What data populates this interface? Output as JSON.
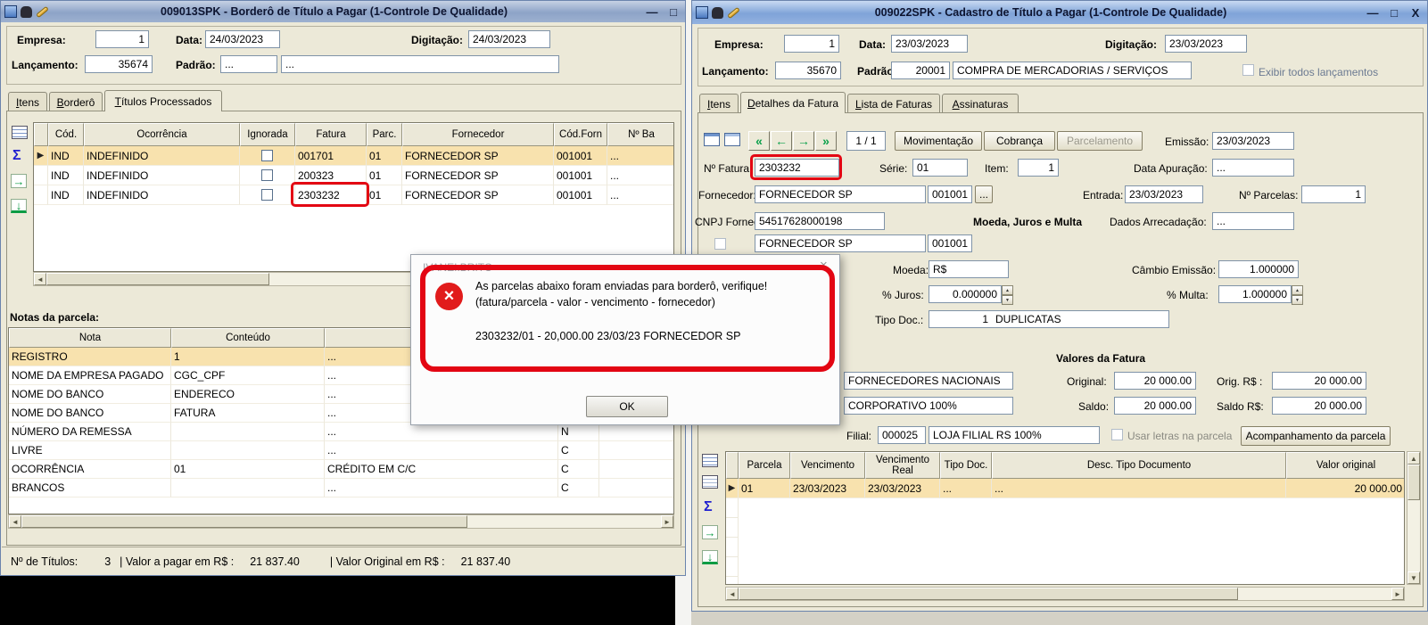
{
  "colors": {
    "window_bg": "#ece9d8",
    "titlebar_active": "#7fa3d8",
    "titlebar_inactive": "#8da3c7",
    "selected_row": "#f8e2ae",
    "annotation_red": "#e30613",
    "error_red": "#e11b1b",
    "nav_green": "#0aa04a",
    "sum_blue": "#1f1fd0"
  },
  "icons": {
    "minimize": "—",
    "maximize": "□",
    "close_x": "X",
    "dialog_close": "×",
    "error_x": "×",
    "sum": "Σ",
    "export_arrow": "→",
    "download_arrow": "↓",
    "nav_first": "«",
    "nav_prev": "←",
    "nav_next": "→",
    "nav_last": "»",
    "scroll_left": "◄",
    "scroll_right": "►",
    "scroll_up": "▲",
    "scroll_down": "▼",
    "spin_up": "▲",
    "spin_down": "▼",
    "row_marker": "▶"
  },
  "left_window": {
    "title": "009013SPK - Borderô de Título a Pagar (1-Controle De Qualidade)",
    "form": {
      "empresa_label": "Empresa:",
      "empresa": "1",
      "data_label": "Data:",
      "data": "24/03/2023",
      "digitacao_label": "Digitação:",
      "digitacao": "24/03/2023",
      "lancamento_label": "Lançamento:",
      "lancamento": "35674",
      "padrao_label": "Padrão:",
      "padrao": "...",
      "padrao_desc": "..."
    },
    "tabs": {
      "itens": "Itens",
      "bordero": "Borderô",
      "titulos": "Títulos Processados"
    },
    "grid": {
      "headers": [
        "Cód.",
        "Ocorrência",
        "Ignorada",
        "Fatura",
        "Parc.",
        "Fornecedor",
        "Cód.Forn",
        "Nº Ba"
      ],
      "rows": [
        {
          "cod": "IND",
          "ocorrencia": "INDEFINIDO",
          "fatura": "001701",
          "parc": "01",
          "fornecedor": "FORNECEDOR SP",
          "cod_forn": "001001",
          "nba": "..."
        },
        {
          "cod": "IND",
          "ocorrencia": "INDEFINIDO",
          "fatura": "200323",
          "parc": "01",
          "fornecedor": "FORNECEDOR SP",
          "cod_forn": "001001",
          "nba": "..."
        },
        {
          "cod": "IND",
          "ocorrencia": "INDEFINIDO",
          "fatura": "2303232",
          "parc": "01",
          "fornecedor": "FORNECEDOR SP",
          "cod_forn": "001001",
          "nba": "..."
        }
      ]
    },
    "notas": {
      "label": "Notas da parcela:",
      "headers": [
        "Nota",
        "Conteúdo"
      ],
      "rows": [
        {
          "nota": "REGISTRO",
          "conteudo": "1",
          "valor": "...",
          "flag": ""
        },
        {
          "nota": "NOME DA EMPRESA PAGADO",
          "conteudo": "CGC_CPF",
          "valor": "...",
          "flag": ""
        },
        {
          "nota": "NOME DO BANCO",
          "conteudo": "ENDERECO",
          "valor": "...",
          "flag": ""
        },
        {
          "nota": "NOME DO BANCO",
          "conteudo": "FATURA",
          "valor": "...",
          "flag": ""
        },
        {
          "nota": "NÚMERO DA REMESSA",
          "conteudo": "",
          "valor": "...",
          "flag": "N"
        },
        {
          "nota": "LIVRE",
          "conteudo": "",
          "valor": "...",
          "flag": "C"
        },
        {
          "nota": "OCORRÊNCIA",
          "conteudo": "01",
          "valor": "CRÉDITO EM C/C",
          "flag": "C"
        },
        {
          "nota": "BRANCOS",
          "conteudo": "",
          "valor": "...",
          "flag": "C"
        }
      ]
    },
    "status": {
      "titulos_label": "Nº de Títulos:",
      "titulos": "3",
      "pagar_label": "| Valor a pagar em R$ :",
      "pagar": "21 837.40",
      "original_label": "| Valor Original em R$ :",
      "original": "21 837.40"
    }
  },
  "dialog": {
    "title": "IVANEI.BRITO",
    "line1": "As parcelas abaixo foram enviadas para borderô, verifique!",
    "line2": "(fatura/parcela - valor - vencimento - fornecedor)",
    "line3": "2303232/01 - 20,000.00 23/03/23 FORNECEDOR SP",
    "ok_label": "OK"
  },
  "right_window": {
    "title": "009022SPK - Cadastro de Título a Pagar (1-Controle De Qualidade)",
    "form": {
      "empresa_label": "Empresa:",
      "empresa": "1",
      "data_label": "Data:",
      "data": "23/03/2023",
      "digitacao_label": "Digitação:",
      "digitacao": "23/03/2023",
      "lancamento_label": "Lançamento:",
      "lancamento": "35670",
      "padrao_label": "Padrão:",
      "padrao": "20001",
      "padrao_desc": "COMPRA DE MERCADORIAS / SERVIÇOS",
      "exibir_label": "Exibir todos lançamentos"
    },
    "tabs": {
      "itens": "Itens",
      "detalhes": "Detalhes da Fatura",
      "lista": "Lista de Faturas",
      "assinaturas": "Assinaturas"
    },
    "nav": {
      "pager": "1 / 1",
      "movimentacao": "Movimentação",
      "cobranca": "Cobrança",
      "parcelamento": "Parcelamento"
    },
    "fatura": {
      "emissao_label": "Emissão:",
      "emissao": "23/03/2023",
      "num_label": "Nº Fatura:",
      "num": "2303232",
      "serie_label": "Série:",
      "serie": "01",
      "item_label": "Item:",
      "item": "1",
      "apuracao_label": "Data Apuração:",
      "apuracao": "...",
      "fornecedor_label": "Fornecedor:",
      "fornecedor": "FORNECEDOR SP",
      "fornecedor_cod": "001001",
      "browse": "...",
      "entrada_label": "Entrada:",
      "entrada": "23/03/2023",
      "parcelas_label": "Nº Parcelas:",
      "parcelas": "1",
      "cnpj_label": "CNPJ Fornec.:",
      "cnpj": "54517628000198",
      "sacado": "FORNECEDOR SP",
      "sacado_cod": "001001"
    },
    "moeda_section": {
      "header": "Moeda, Juros e Multa",
      "arrecadacao_label": "Dados Arrecadação:",
      "arrecadacao": "...",
      "moeda_label": "Moeda:",
      "moeda": "R$",
      "cambio_label": "Câmbio Emissão:",
      "cambio": "1.000000",
      "juros_label": "% Juros:",
      "juros": "0.000000",
      "multa_label": "% Multa:",
      "multa": "1.000000",
      "tipo_doc_label": "Tipo Doc.:",
      "tipo_doc_num": "1",
      "tipo_doc_desc": "DUPLICATAS"
    },
    "valores": {
      "header": "Valores da Fatura",
      "grupo": "FORNECEDORES NACIONAIS",
      "original_label": "Original:",
      "original": "20 000.00",
      "orig_rs_label": "Orig. R$ :",
      "orig_rs": "20 000.00",
      "corporativo": "CORPORATIVO 100%",
      "saldo_label": "Saldo:",
      "saldo": "20 000.00",
      "saldo_rs_label": "Saldo R$:",
      "saldo_rs": "20 000.00",
      "filial_label": "Filial:",
      "filial": "000025",
      "filial_desc": "LOJA FILIAL RS 100%",
      "usar_letras_label": "Usar letras na parcela",
      "acompanhamento_label": "Acompanhamento da parcela"
    },
    "parcelas_grid": {
      "headers": [
        "Parcela",
        "Vencimento",
        "Vencimento Real",
        "Tipo Doc.",
        "Desc. Tipo Documento",
        "Valor original"
      ],
      "rows": [
        {
          "parcela": "01",
          "vencimento": "23/03/2023",
          "vencimento_real": "23/03/2023",
          "tipo_doc": "...",
          "desc": "...",
          "valor": "20 000.00"
        }
      ]
    }
  }
}
